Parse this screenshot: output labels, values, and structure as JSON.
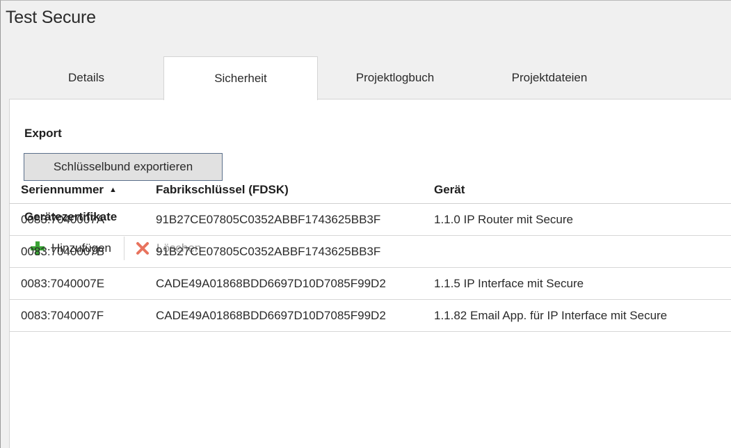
{
  "window": {
    "title": "Test Secure"
  },
  "tabs": [
    {
      "label": "Details",
      "active": false
    },
    {
      "label": "Sicherheit",
      "active": true
    },
    {
      "label": "Projektlogbuch",
      "active": false
    },
    {
      "label": "Projektdateien",
      "active": false
    }
  ],
  "export": {
    "heading": "Export",
    "button_label": "Schlüsselbund exportieren"
  },
  "certificates": {
    "heading": "Gerätezertifikate",
    "toolbar": {
      "add_label": "Hinzufügen",
      "add_icon": "plus-icon",
      "delete_label": "Löschen",
      "delete_icon": "x-icon",
      "delete_enabled": false
    },
    "columns": {
      "serial": "Seriennummer",
      "fdsk": "Fabrikschlüssel (FDSK)",
      "device": "Gerät",
      "sort_column": "serial",
      "sort_direction": "ascending"
    },
    "rows": [
      {
        "serial": "0083:7040007A",
        "fdsk": "91B27CE07805C0352ABBF1743625BB3F",
        "device": "1.1.0 IP Router mit Secure"
      },
      {
        "serial": "0083:7040007B",
        "fdsk": "91B27CE07805C0352ABBF1743625BB3F",
        "device": ""
      },
      {
        "serial": "0083:7040007E",
        "fdsk": "CADE49A01868BDD6697D10D7085F99D2",
        "device": "1.1.5 IP Interface mit Secure"
      },
      {
        "serial": "0083:7040007F",
        "fdsk": "CADE49A01868BDD6697D10D7085F99D2",
        "device": "1.1.82 Email App. für IP Interface mit Secure"
      }
    ]
  },
  "colors": {
    "add_icon": "#3aa335",
    "delete_icon": "#e8735e",
    "tab_active_bg": "#ffffff",
    "window_bg": "#f0f0f0"
  }
}
